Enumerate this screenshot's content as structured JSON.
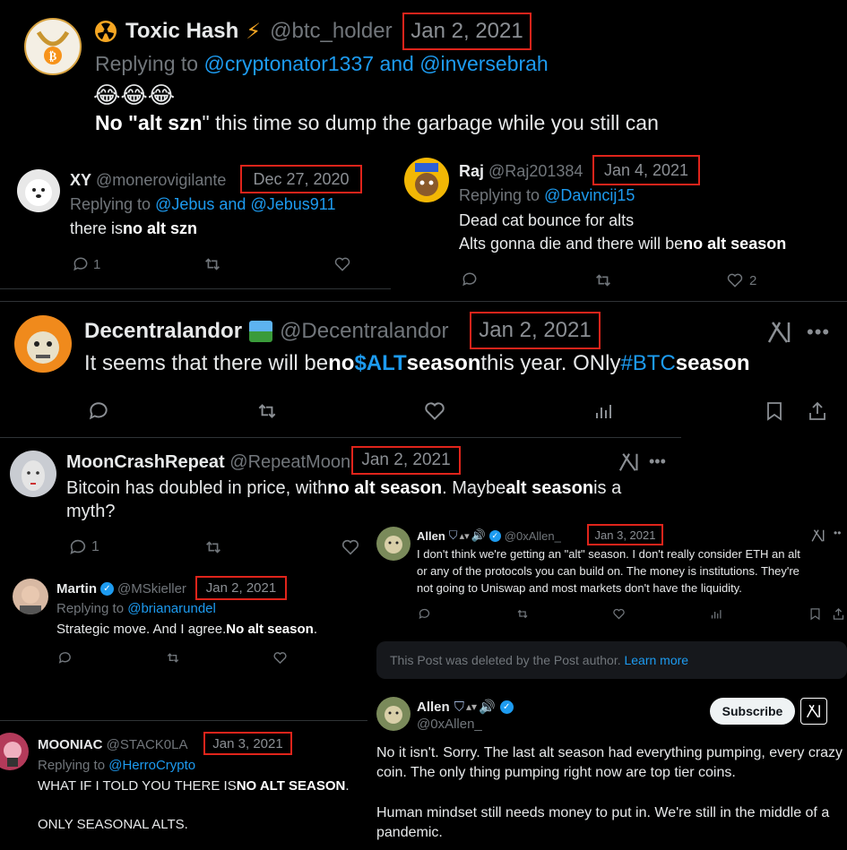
{
  "t1": {
    "name": "Toxic Hash",
    "handle": "@btc_holder",
    "date": "Jan 2, 2021",
    "replying": "Replying to",
    "r1": "@cryptonator1337",
    "and": "and",
    "r2": "@inversebrah",
    "emoji": "😂😂😂",
    "text_a": "No \"",
    "text_b": "alt szn",
    "text_c": "\" this time so dump the garbage while you still can"
  },
  "t2": {
    "name": "XY",
    "handle": "@monerovigilante",
    "date": "Dec 27, 2020",
    "replying": "Replying to",
    "r1": "@Jebus",
    "and": "and",
    "r2": "@Jebus911",
    "text_a": "there is ",
    "text_b": "no alt szn",
    "reply_count": "1"
  },
  "t3": {
    "name": "Raj",
    "handle": "@Raj201384",
    "date": "Jan 4, 2021",
    "replying": "Replying to",
    "r1": "@Davincij15",
    "line1": "Dead cat bounce for alts",
    "line2_a": "Alts gonna die and there will be ",
    "line2_b": "no alt season",
    "like_count": "2"
  },
  "t4": {
    "name": "Decentralandor",
    "handle": "@Decentralandor",
    "date": "Jan 2, 2021",
    "text_a": "It seems that there will be ",
    "text_b": "no ",
    "tag1": "$ALT",
    "text_c": " season",
    "text_d": " this year. ONly ",
    "tag2": "#BTC",
    "text_e": " season"
  },
  "t5": {
    "name": "MoonCrashRepeat",
    "handle": "@RepeatMoon",
    "date": "Jan 2, 2021",
    "l1_a": "Bitcoin has doubled in price, with ",
    "l1_b": "no alt season",
    "l1_c": ". Maybe ",
    "l1_d": "alt season",
    "l1_e": " is a",
    "l2": "myth?",
    "reply_count": "1"
  },
  "t6": {
    "name": "Allen",
    "handle": "@0xAllen_",
    "date": "Jan 3, 2021",
    "l1": "I don't think we're getting an \"alt\" season. I don't really consider ETH an alt",
    "l2": "or any of the protocols you can build on. The money is institutions. They're",
    "l3": "not going to Uniswap and most markets don't have the liquidity."
  },
  "t7": {
    "name": "Martin",
    "handle": "@MSkieller",
    "date": "Jan 2, 2021",
    "replying": "Replying to",
    "r1": "@brianarundel",
    "text_a": "Strategic move. And I agree. ",
    "text_b": "No alt season",
    "text_c": "."
  },
  "deleted": {
    "text": "This Post was deleted by the Post author.",
    "link": "Learn more"
  },
  "t8": {
    "name": "Allen",
    "handle": "@0xAllen_",
    "subscribe": "Subscribe",
    "l1": "No it isn't. Sorry. The last alt season had everything pumping, every crazy",
    "l2": "coin. The only thing pumping right now are top tier coins.",
    "l3": "Human mindset still needs money to put in. We're still in the middle of a",
    "l4": "pandemic."
  },
  "t9": {
    "name": "MOONIAC",
    "handle": "@STACK0LA",
    "date": "Jan 3, 2021",
    "replying": "Replying to",
    "r1": "@HerroCrypto",
    "l1_a": "WHAT IF I TOLD YOU THERE IS ",
    "l1_b": "NO ALT SEASON",
    "l1_c": ".",
    "l2": "ONLY SEASONAL ALTS."
  },
  "colors": {
    "accent": "#1d9bf0",
    "highlight_box": "#e0241b",
    "muted": "#71767b",
    "verified": "#1d9bf0"
  }
}
